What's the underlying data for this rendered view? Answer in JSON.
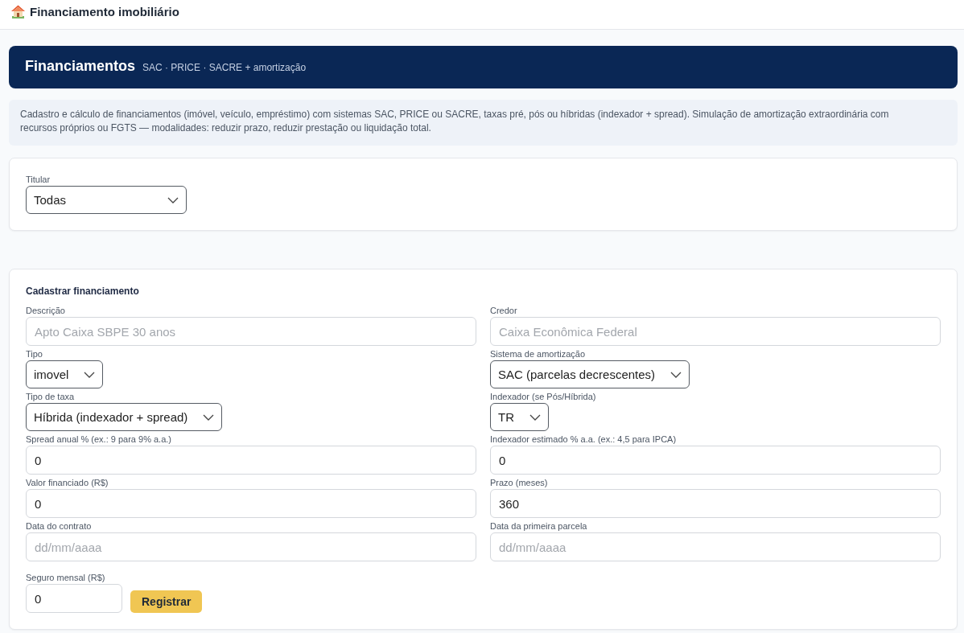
{
  "app_bar": {
    "title": "Financiamento imobiliário"
  },
  "banner": {
    "title": "Financiamentos",
    "subtitle": "SAC · PRICE · SACRE + amortização"
  },
  "description": "Cadastro e cálculo de financiamentos (imóvel, veículo, empréstimo) com sistemas SAC, PRICE ou SACRE, taxas pré, pós ou híbridas (indexador + spread). Simulação de amortização extraordinária com recursos próprios ou FGTS — modalidades: reduzir prazo, reduzir prestação ou liquidação total.",
  "filter": {
    "label": "Titular",
    "value": "Todas"
  },
  "form": {
    "title": "Cadastrar financiamento",
    "fields": [
      {
        "kind": "input",
        "label": "Descrição",
        "placeholder": "Apto Caixa SBPE 30 anos"
      },
      {
        "kind": "input",
        "label": "Credor",
        "placeholder": "Caixa Econômica Federal"
      },
      {
        "kind": "select",
        "label": "Tipo",
        "value": "imovel"
      },
      {
        "kind": "select",
        "label": "Sistema de amortização",
        "value": "SAC (parcelas decrescentes)"
      },
      {
        "kind": "select",
        "label": "Tipo de taxa",
        "value": "Híbrida (indexador + spread)"
      },
      {
        "kind": "select",
        "label": "Indexador (se Pós/Híbrida)",
        "value": "TR"
      },
      {
        "kind": "input",
        "label": "Spread anual % (ex.: 9 para 9% a.a.)",
        "value": "0"
      },
      {
        "kind": "input",
        "label": "Indexador estimado % a.a. (ex.: 4,5 para IPCA)",
        "value": "0"
      },
      {
        "kind": "input",
        "label": "Valor financiado (R$)",
        "value": "0"
      },
      {
        "kind": "input",
        "label": "Prazo (meses)",
        "value": "360"
      },
      {
        "kind": "input",
        "label": "Data do contrato",
        "placeholder": "dd/mm/aaaa"
      },
      {
        "kind": "input",
        "label": "Data da primeira parcela",
        "placeholder": "dd/mm/aaaa"
      }
    ],
    "insurance": {
      "label": "Seguro mensal (R$)",
      "value": "0"
    },
    "submit": "Registrar"
  }
}
